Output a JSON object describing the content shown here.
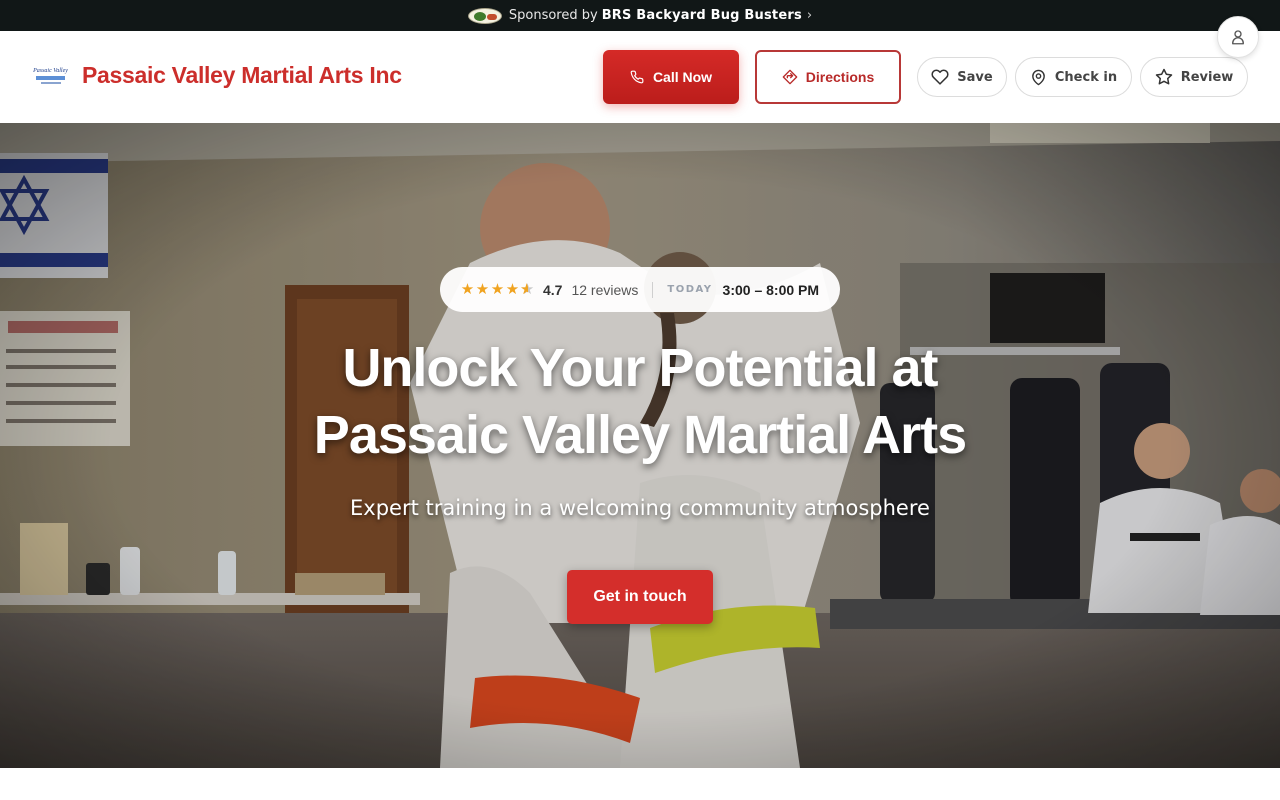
{
  "sponsor": {
    "prefix": "Sponsored by",
    "name": "BRS Backyard Bug Busters",
    "chevron": "›",
    "logo_icon": "sponsor-logo"
  },
  "header": {
    "business_name": "Passaic Valley Martial Arts Inc",
    "logo_text": "Passaic Valley",
    "call_label": "Call Now",
    "directions_label": "Directions",
    "save_label": "Save",
    "checkin_label": "Check in",
    "review_label": "Review"
  },
  "hero": {
    "rating": "4.7",
    "rating_stars": 4.5,
    "reviews": "12 reviews",
    "today_label": "TODAY",
    "hours": "3:00 – 8:00 PM",
    "title": "Unlock Your Potential at Passaic Valley Martial Arts",
    "subtitle": "Expert training in a welcoming community atmosphere",
    "cta_label": "Get in touch"
  },
  "colors": {
    "brand_red": "#cc2e2b",
    "sponsor_bar": "#111717",
    "star": "#f0a320"
  },
  "icons": [
    "phone-icon",
    "directions-icon",
    "heart-icon",
    "map-pin-icon",
    "star-icon",
    "user-icon"
  ]
}
